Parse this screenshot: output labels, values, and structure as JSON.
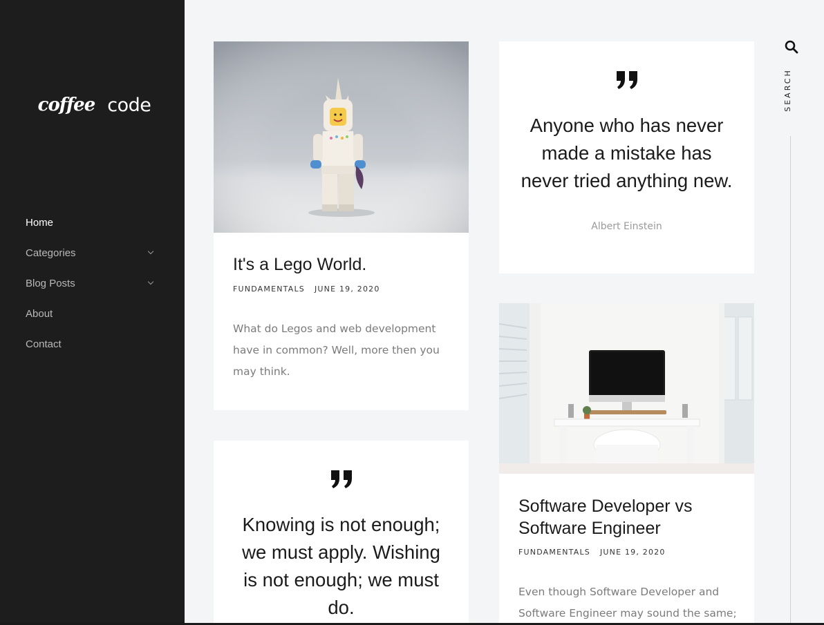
{
  "brand": {
    "logo_word_1": "coffee",
    "logo_word_2": "code"
  },
  "nav": {
    "items": [
      {
        "label": "Home",
        "active": true,
        "has_submenu": false
      },
      {
        "label": "Categories",
        "active": false,
        "has_submenu": true
      },
      {
        "label": "Blog Posts",
        "active": false,
        "has_submenu": true
      },
      {
        "label": "About",
        "active": false,
        "has_submenu": false
      },
      {
        "label": "Contact",
        "active": false,
        "has_submenu": false
      }
    ]
  },
  "posts": [
    {
      "title": "It's a Lego World.",
      "category": "FUNDAMENTALS",
      "date": "JUNE 19, 2020",
      "excerpt": "What do Legos and web development have in common? Well, more then you may think."
    },
    {
      "title": "Software Developer vs Software Engineer",
      "category": "FUNDAMENTALS",
      "date": "JUNE 19, 2020",
      "excerpt": "Even though Software Developer and Software Engineer may sound the same;"
    }
  ],
  "quotes": [
    {
      "text": "Anyone who has never made a mistake has never tried anything new.",
      "author": "Albert Einstein"
    },
    {
      "text": "Knowing is not enough; we must apply. Wishing is not enough; we must do."
    }
  ],
  "search": {
    "label": "SEARCH",
    "icon": "search-icon"
  },
  "colors": {
    "sidebar_bg": "#1d1d1d",
    "page_bg": "#f4f5f7",
    "card_bg": "#ffffff",
    "text_muted": "#7b7b7b"
  }
}
